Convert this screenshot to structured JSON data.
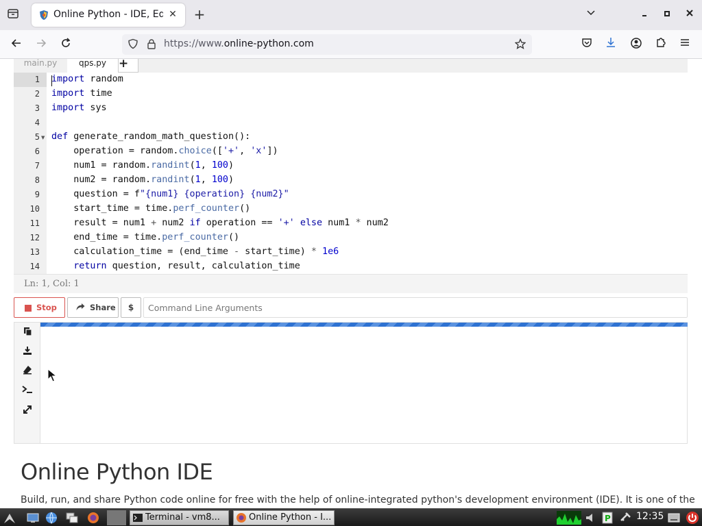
{
  "browser": {
    "tab_title": "Online Python - IDE, Edit",
    "url_prefix": "https://www.",
    "url_domain": "online-python.com"
  },
  "editor": {
    "file_tabs": [
      "main.py",
      "qps.py"
    ],
    "add_tab_label": "+",
    "line_numbers": [
      "1",
      "2",
      "3",
      "4",
      "5",
      "6",
      "7",
      "8",
      "9",
      "10",
      "11",
      "12",
      "13",
      "14"
    ],
    "status": "Ln: 1, Col: 1"
  },
  "toolbar": {
    "stop_label": "Stop",
    "share_label": "Share",
    "dollar_label": "$",
    "args_placeholder": "Command Line Arguments"
  },
  "content": {
    "heading": "Online Python IDE",
    "paragraph": "Build, run, and share Python code online for free with the help of online-integrated python's development environment (IDE). It is one of the"
  },
  "taskbar": {
    "tasks": [
      "Terminal - vm8...",
      "Online Python - I..."
    ],
    "clock": "12:35"
  },
  "colors": {
    "stop": "#d9534f",
    "progress": "#2e72d2",
    "keyword": "#0000a2"
  }
}
